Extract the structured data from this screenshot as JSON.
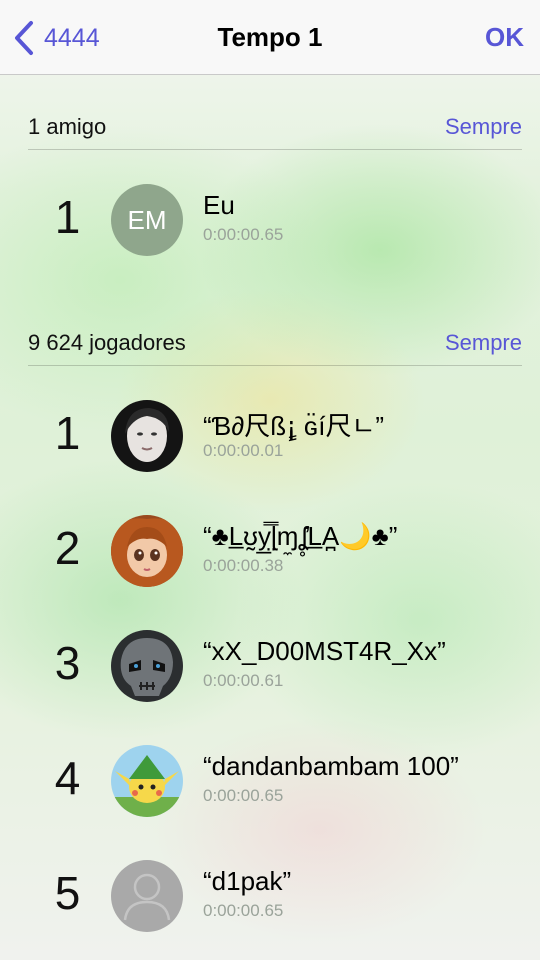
{
  "nav": {
    "back_label": "4444",
    "title": "Tempo 1",
    "ok_label": "OK"
  },
  "colors": {
    "accent": "#5856d6",
    "secondary_text": "#9aa39a"
  },
  "friends_section": {
    "title": "1 amigo",
    "filter": "Sempre",
    "rows": [
      {
        "rank": "1",
        "initials": "EM",
        "name": "Eu",
        "time": "0:00:00.65"
      }
    ]
  },
  "players_section": {
    "title": "9 624 jogadores",
    "filter": "Sempre",
    "rows": [
      {
        "rank": "1",
        "name": "“Ɓ∂尺ß¡ٍ ɢ̈í尺ㄴ”",
        "time": "0:00:00.01",
        "avatar": "photo-woman"
      },
      {
        "rank": "2",
        "name": "“♣L̲ʊ̰y̲̤̿ɭɱ̼ʆ̥̓L̲A̪🌙♣”",
        "time": "0:00:00.38",
        "avatar": "doll"
      },
      {
        "rank": "3",
        "name": "“xX_D00MST4R_Xx”",
        "time": "0:00:00.61",
        "avatar": "dark-skull"
      },
      {
        "rank": "4",
        "name": "“dandanbambam 100”",
        "time": "0:00:00.65",
        "avatar": "cartoon-character"
      },
      {
        "rank": "5",
        "name": "“d1pak”",
        "time": "0:00:00.65",
        "avatar": "default-silhouette"
      }
    ]
  }
}
